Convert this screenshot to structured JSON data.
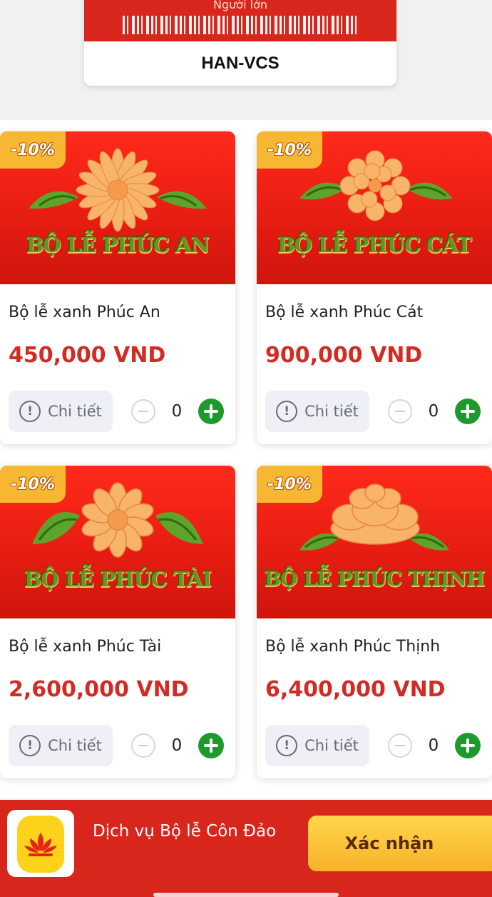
{
  "ticket": {
    "label": "Người lớn",
    "code": "HAN-VCS"
  },
  "products": [
    {
      "banner_title": "BỘ LỄ PHÚC AN",
      "discount": "-10%",
      "name": "Bộ lễ xanh Phúc An",
      "price": "450,000 VND",
      "detail_label": "Chi tiết",
      "quantity": "0"
    },
    {
      "banner_title": "BỘ LỄ PHÚC CÁT",
      "discount": "-10%",
      "name": "Bộ lễ xanh Phúc Cát",
      "price": "900,000 VND",
      "detail_label": "Chi tiết",
      "quantity": "0"
    },
    {
      "banner_title": "BỘ LỄ PHÚC TÀI",
      "discount": "-10%",
      "name": "Bộ lễ xanh Phúc Tài",
      "price": "2,600,000 VND",
      "detail_label": "Chi tiết",
      "quantity": "0"
    },
    {
      "banner_title": "BỘ LỄ PHÚC THỊNH",
      "discount": "-10%",
      "name": "Bộ lễ xanh Phúc Thịnh",
      "price": "6,400,000 VND",
      "detail_label": "Chi tiết",
      "quantity": "0"
    }
  ],
  "bottom_bar": {
    "service_name": "Dịch vụ Bộ lễ Côn Đảo",
    "confirm_label": "Xác nhận"
  },
  "colors": {
    "brand_red": "#d9261c",
    "price_red": "#d42a24",
    "plus_green": "#1d9a2c",
    "badge_orange": "#f7b733",
    "confirm_yellow": "#ffd64a"
  },
  "icons": {
    "detail": "info-circle-icon",
    "decrement": "minus-circle-icon",
    "increment": "plus-circle-icon",
    "banner_flower": "chrysanthemum-icon",
    "service": "lotus-icon"
  }
}
